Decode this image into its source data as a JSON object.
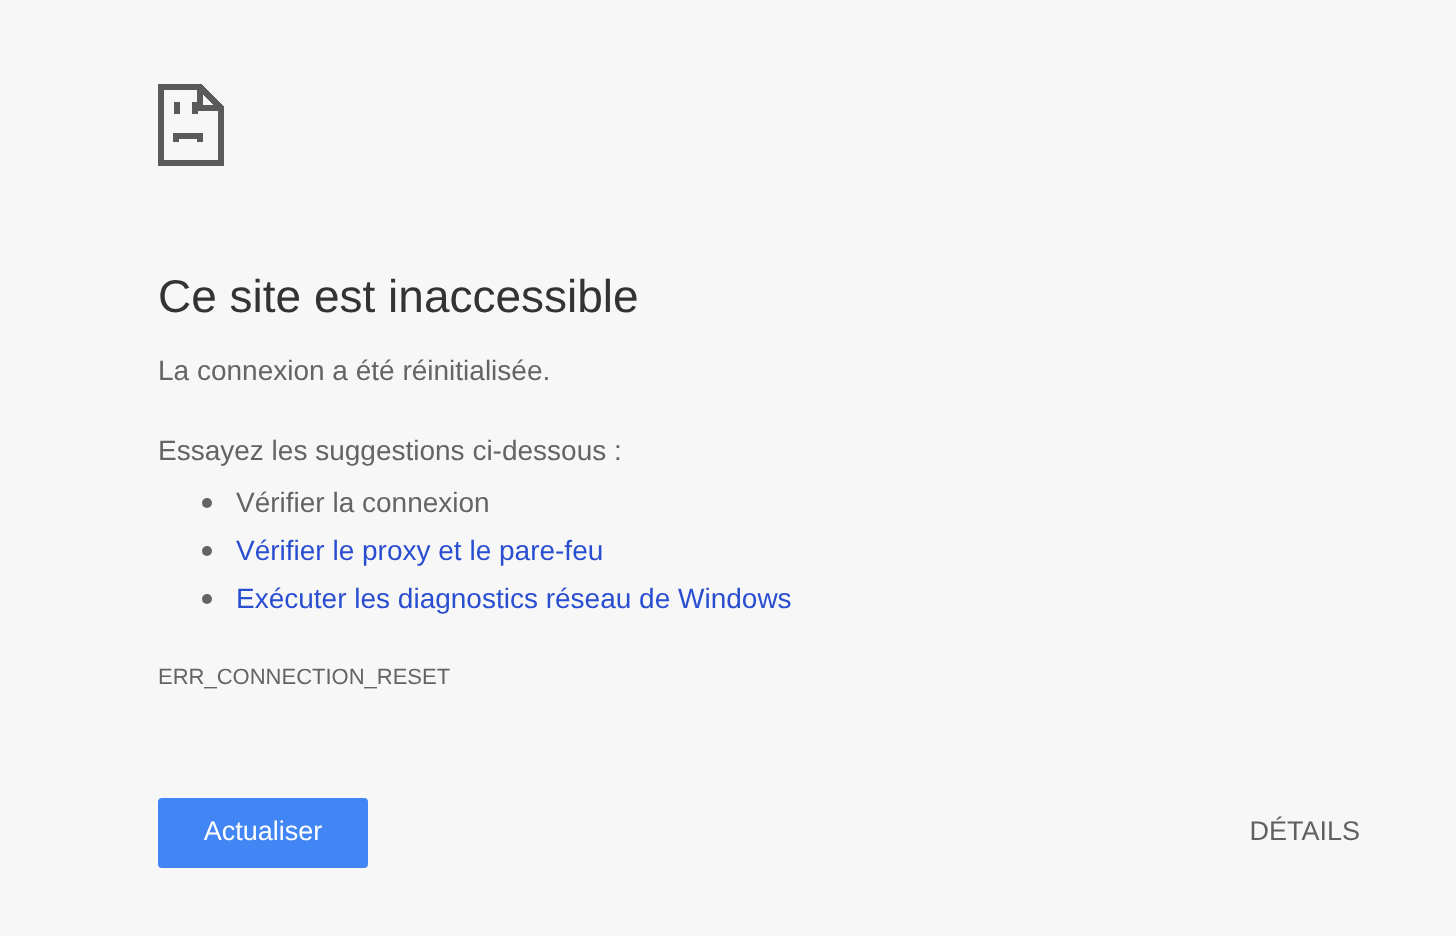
{
  "heading": "Ce site est inaccessible",
  "summary": "La connexion a été réinitialisée.",
  "suggestions_intro": "Essayez les suggestions ci-dessous :",
  "suggestions": [
    {
      "kind": "text",
      "label": "Vérifier la connexion"
    },
    {
      "kind": "link",
      "label": "Vérifier le proxy et le pare-feu"
    },
    {
      "kind": "link",
      "label": "Exécuter les diagnostics réseau de Windows"
    }
  ],
  "error_code": "ERR_CONNECTION_RESET",
  "buttons": {
    "reload": "Actualiser",
    "details": "DÉTAILS"
  }
}
